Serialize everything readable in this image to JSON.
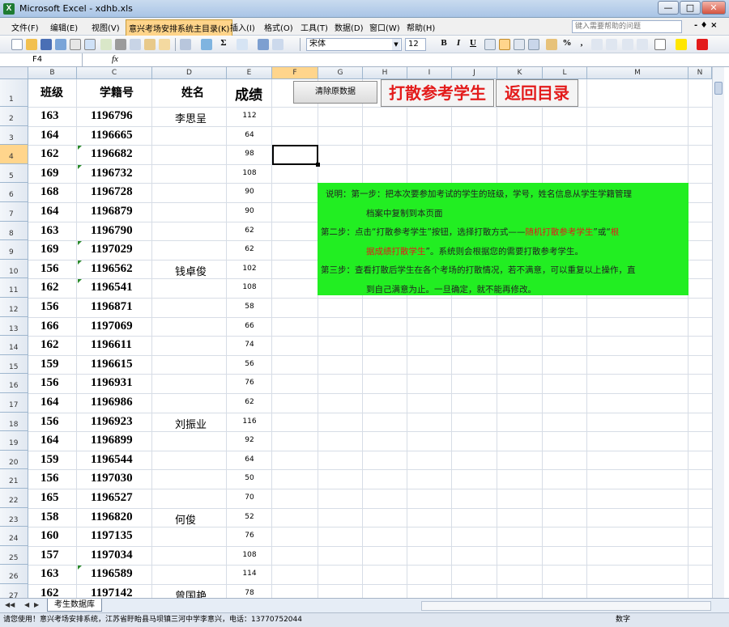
{
  "window": {
    "title": "Microsoft Excel - xdhb.xls",
    "controls": {
      "min": "—",
      "max": "□",
      "close": "✕"
    }
  },
  "menu": {
    "items": [
      "文件(F)",
      "编辑(E)",
      "视图(V)",
      "意兴考场安排系统主目录(K)",
      "插入(I)",
      "格式(O)",
      "工具(T)",
      "数据(D)",
      "窗口(W)",
      "帮助(H)"
    ],
    "help_placeholder": "键入需要帮助的问题",
    "doc_controls": "- ♦ ×"
  },
  "toolbar": {
    "font_name": "宋体",
    "font_size": "12",
    "bold": "B",
    "italic": "I",
    "underline": "U",
    "currency": "%",
    "comma": ","
  },
  "formula_bar": {
    "name_box": "F4",
    "fx": "fx",
    "content": ""
  },
  "columns": [
    "B",
    "C",
    "D",
    "E",
    "F",
    "G",
    "H",
    "I",
    "J",
    "K",
    "L",
    "M",
    "N"
  ],
  "headers": {
    "class": "班级",
    "student_id": "学籍号",
    "name": "姓名",
    "score": "成绩"
  },
  "rows": [
    {
      "num": "2",
      "cls": "163",
      "id": "1196796",
      "name": "李思呈",
      "score": "112",
      "tri": false
    },
    {
      "num": "3",
      "cls": "164",
      "id": "1196665",
      "name": "",
      "score": "64",
      "tri": false
    },
    {
      "num": "4",
      "cls": "162",
      "id": "1196682",
      "name": "",
      "score": "98",
      "tri": true
    },
    {
      "num": "5",
      "cls": "169",
      "id": "1196732",
      "name": "",
      "score": "108",
      "tri": true
    },
    {
      "num": "6",
      "cls": "168",
      "id": "1196728",
      "name": "",
      "score": "90",
      "tri": false
    },
    {
      "num": "7",
      "cls": "164",
      "id": "1196879",
      "name": "",
      "score": "90",
      "tri": false
    },
    {
      "num": "8",
      "cls": "163",
      "id": "1196790",
      "name": "",
      "score": "62",
      "tri": false
    },
    {
      "num": "9",
      "cls": "169",
      "id": "1197029",
      "name": "",
      "score": "62",
      "tri": true
    },
    {
      "num": "10",
      "cls": "156",
      "id": "1196562",
      "name": "钱卓俊",
      "score": "102",
      "tri": true
    },
    {
      "num": "11",
      "cls": "162",
      "id": "1196541",
      "name": "",
      "score": "108",
      "tri": true
    },
    {
      "num": "12",
      "cls": "156",
      "id": "1196871",
      "name": "",
      "score": "58",
      "tri": false
    },
    {
      "num": "13",
      "cls": "166",
      "id": "1197069",
      "name": "",
      "score": "66",
      "tri": false
    },
    {
      "num": "14",
      "cls": "162",
      "id": "1196611",
      "name": "",
      "score": "74",
      "tri": false
    },
    {
      "num": "15",
      "cls": "159",
      "id": "1196615",
      "name": "",
      "score": "56",
      "tri": false
    },
    {
      "num": "16",
      "cls": "156",
      "id": "1196931",
      "name": "",
      "score": "76",
      "tri": false
    },
    {
      "num": "17",
      "cls": "164",
      "id": "1196986",
      "name": "",
      "score": "62",
      "tri": false
    },
    {
      "num": "18",
      "cls": "156",
      "id": "1196923",
      "name": "刘振业",
      "score": "116",
      "tri": false
    },
    {
      "num": "19",
      "cls": "164",
      "id": "1196899",
      "name": "",
      "score": "92",
      "tri": false
    },
    {
      "num": "20",
      "cls": "159",
      "id": "1196544",
      "name": "",
      "score": "64",
      "tri": false
    },
    {
      "num": "21",
      "cls": "156",
      "id": "1197030",
      "name": "",
      "score": "50",
      "tri": false
    },
    {
      "num": "22",
      "cls": "165",
      "id": "1196527",
      "name": "",
      "score": "70",
      "tri": false
    },
    {
      "num": "23",
      "cls": "158",
      "id": "1196820",
      "name": "何俊",
      "score": "52",
      "tri": false
    },
    {
      "num": "24",
      "cls": "160",
      "id": "1197135",
      "name": "",
      "score": "76",
      "tri": false
    },
    {
      "num": "25",
      "cls": "157",
      "id": "1197034",
      "name": "",
      "score": "108",
      "tri": false
    },
    {
      "num": "26",
      "cls": "163",
      "id": "1196589",
      "name": "",
      "score": "114",
      "tri": true
    },
    {
      "num": "27",
      "cls": "162",
      "id": "1197142",
      "name": "曾国艳",
      "score": "78",
      "tri": false
    }
  ],
  "buttons": {
    "clear": "清除原数据",
    "shuffle": "打散参考学生",
    "back": "返回目录"
  },
  "note": {
    "line1": "说明：第一步：把本次要参加考试的学生的班级，学号，姓名信息从学生学籍管理",
    "line2": "档案中复制到本页面",
    "line3a": "第二步：点击“打散参考学生”按钮，选择打散方式——",
    "line3b": "随机打散参考学生",
    "line3c": "”或“",
    "line3d": "根",
    "line4a": "据成绩打散学生",
    "line4b": "”。系统则会根据您的需要打散参考学生。",
    "line5": "第三步：查看打散后学生在各个考场的打散情况，若不满意，可以重复以上操作，直",
    "line6": "到自己满意为止。一旦确定，就不能再修改。"
  },
  "sheet_tab": "考生数据库",
  "status": {
    "left": "请您使用！意兴考场安排系统，江苏省盱眙县马坝镇三河中学李意兴，电话：13770752044",
    "right": "数字"
  },
  "colors": {
    "note_bg": "#22ee22",
    "button_red_text": "#e31b1b",
    "active_header": "#ffd58c"
  }
}
